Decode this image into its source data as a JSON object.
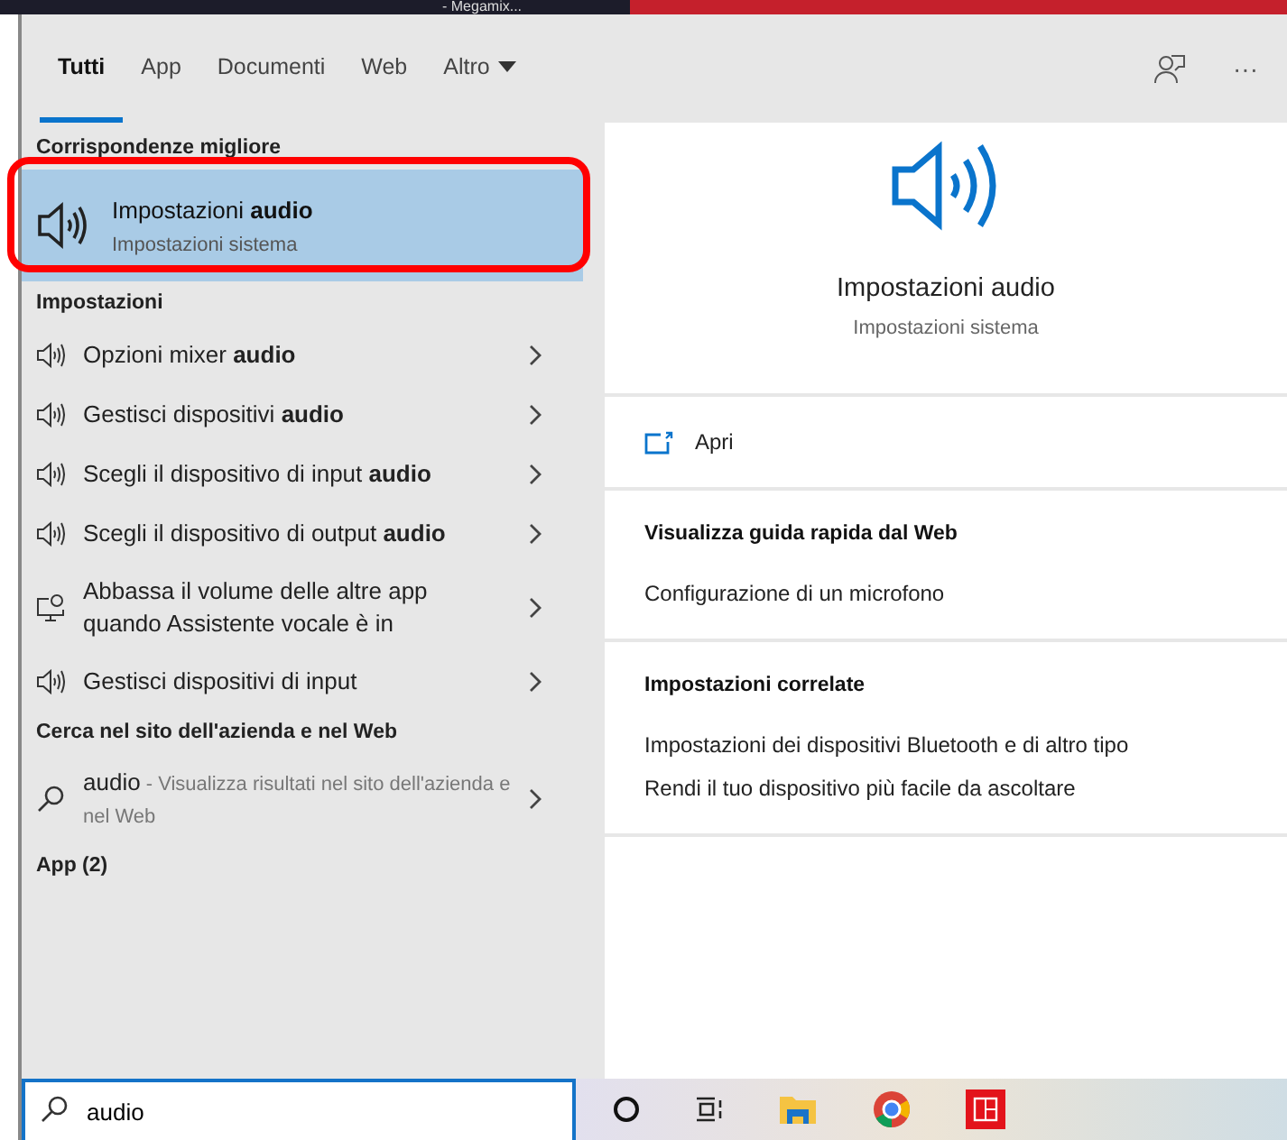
{
  "top_strip": {
    "title": "- Megamix..."
  },
  "tabs": [
    {
      "label": "Tutti",
      "selected": true,
      "kind": "plain"
    },
    {
      "label": "App",
      "selected": false,
      "kind": "plain"
    },
    {
      "label": "Documenti",
      "selected": false,
      "kind": "plain"
    },
    {
      "label": "Web",
      "selected": false,
      "kind": "plain"
    },
    {
      "label": "Altro",
      "selected": false,
      "kind": "dropdown"
    }
  ],
  "more_button": "···",
  "best_match": {
    "heading": "Corrispondenze migliore",
    "title": "Impostazioni **audio**",
    "subtitle": "Impostazioni sistema",
    "selected": true,
    "outlined": true
  },
  "sections": [
    {
      "heading": "Impostazioni",
      "items": [
        {
          "kind": "speaker",
          "label": "Opzioni mixer **audio**"
        },
        {
          "kind": "speaker",
          "label": "Gestisci dispositivi **audio**"
        },
        {
          "kind": "speaker",
          "label": "Scegli il dispositivo di input **audio**"
        },
        {
          "kind": "speaker",
          "label": "Scegli il dispositivo di output **audio**"
        },
        {
          "kind": "narrator",
          "label": "Abbassa il volume delle altre app quando Assistente vocale è in"
        },
        {
          "kind": "speaker",
          "label": "Gestisci dispositivi di input"
        }
      ]
    },
    {
      "heading": "Cerca nel sito dell'azienda e nel Web",
      "items": [
        {
          "kind": "web",
          "label": "audio",
          "description": " - Visualizza risultati nel sito dell'azienda e nel Web"
        }
      ]
    },
    {
      "heading": "App (2)"
    }
  ],
  "preview": {
    "title": "Impostazioni audio",
    "subtitle": "Impostazioni sistema",
    "open_action": "Apri",
    "groups": [
      {
        "heading": "Visualizza guida rapida dal Web",
        "links": [
          "Configurazione di un microfono"
        ]
      },
      {
        "heading": "Impostazioni correlate",
        "links": [
          "Impostazioni dei dispositivi Bluetooth e di altro tipo",
          "Rendi il tuo dispositivo più facile da ascoltare"
        ]
      }
    ]
  },
  "search": {
    "value": "audio"
  },
  "taskbar": [
    {
      "kind": "cortana"
    },
    {
      "kind": "taskview"
    },
    {
      "kind": "explorer"
    },
    {
      "kind": "chrome"
    },
    {
      "kind": "red-app"
    }
  ]
}
